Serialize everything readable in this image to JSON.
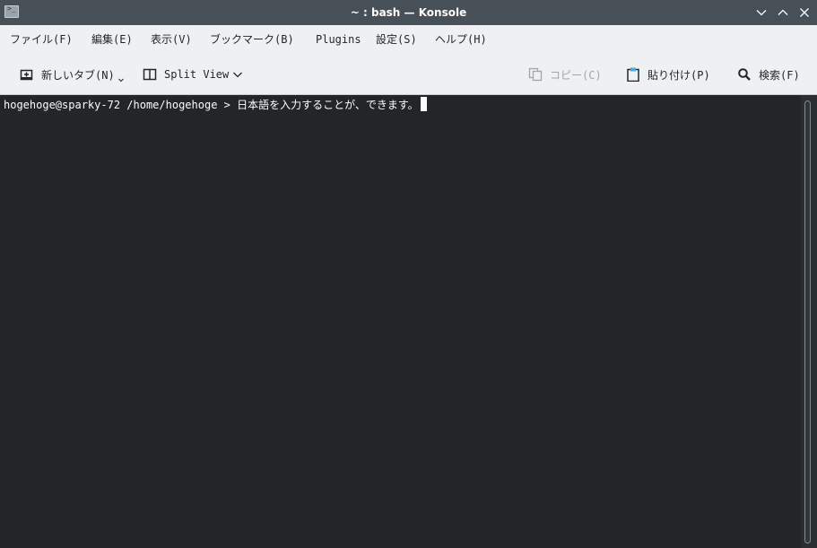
{
  "window": {
    "title": "~ : bash — Konsole",
    "app_icon_glyph": ">_"
  },
  "titlebar_buttons": [
    {
      "name": "minimize",
      "icon": "chevron-down-icon"
    },
    {
      "name": "maximize",
      "icon": "chevron-up-icon"
    },
    {
      "name": "close",
      "icon": "close-icon"
    }
  ],
  "menu": [
    "ファイル(F)",
    "編集(E)",
    "表示(V)",
    "ブックマーク(B)",
    "Plugins",
    "設定(S)",
    "ヘルプ(H)"
  ],
  "toolbar": {
    "new_tab_label": "新しいタブ(N)",
    "split_view_label": "Split View",
    "copy_label": "コピー(C)",
    "paste_label": "貼り付け(P)",
    "search_label": "検索(F)"
  },
  "terminal": {
    "prompt": "hogehoge@sparky-72 /home/hogehoge > ",
    "input": "日本語を入力することが、できます。"
  },
  "colors": {
    "titlebar": "#475057",
    "menubar": "#eff0f1",
    "terminal_bg": "#232627",
    "terminal_fg": "#fcfcfc"
  }
}
